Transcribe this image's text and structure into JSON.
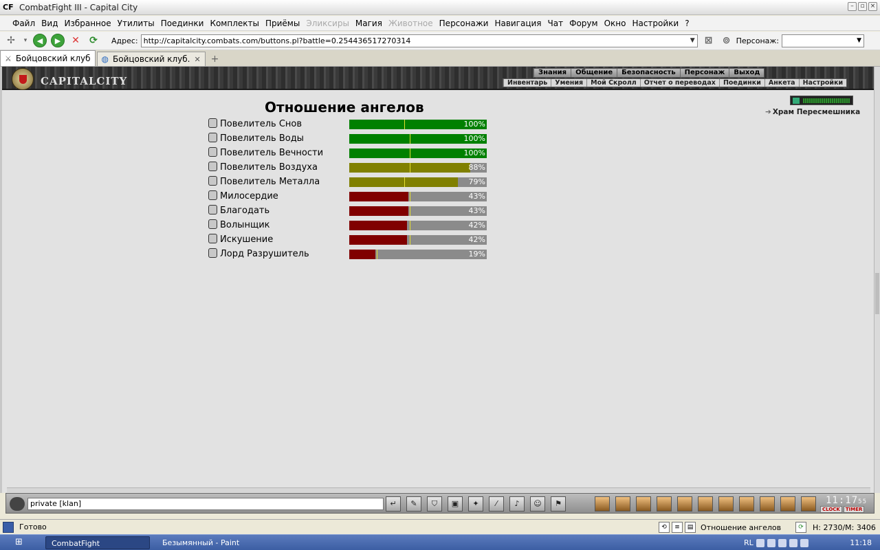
{
  "window": {
    "app_icon": "CF",
    "title": "CombatFight III - Capital City",
    "buttons": [
      "–",
      "▫",
      "×"
    ]
  },
  "menu": [
    {
      "label": "Файл",
      "disabled": false
    },
    {
      "label": "Вид",
      "disabled": false
    },
    {
      "label": "Избранное",
      "disabled": false
    },
    {
      "label": "Утилиты",
      "disabled": false
    },
    {
      "label": "Поединки",
      "disabled": false
    },
    {
      "label": "Комплекты",
      "disabled": false
    },
    {
      "label": "Приёмы",
      "disabled": false
    },
    {
      "label": "Эликсиры",
      "disabled": true
    },
    {
      "label": "Магия",
      "disabled": false
    },
    {
      "label": "Животное",
      "disabled": true
    },
    {
      "label": "Персонажи",
      "disabled": false
    },
    {
      "label": "Навигация",
      "disabled": false
    },
    {
      "label": "Чат",
      "disabled": false
    },
    {
      "label": "Форум",
      "disabled": false
    },
    {
      "label": "Окно",
      "disabled": false
    },
    {
      "label": "Настройки",
      "disabled": false
    },
    {
      "label": "?",
      "disabled": false
    }
  ],
  "address": {
    "label": "Адрес:",
    "url": "http://capitalcity.combats.com/buttons.pl?battle=0.254436517270314",
    "character_label": "Персонаж:",
    "character_value": ""
  },
  "tabs": [
    {
      "label": "Бойцовский клуб",
      "active": true
    },
    {
      "label": "Бойцовский клуб.",
      "active": false
    }
  ],
  "game": {
    "logo_text": "CAPITALCITY",
    "nav_top": [
      "Знания",
      "Общение",
      "Безопасность",
      "Персонаж",
      "Выход"
    ],
    "nav_sub": [
      "Инвентарь",
      "Умения",
      "Мой Скролл",
      "Отчет о переводах",
      "Поединки",
      "Анкета",
      "Настройки"
    ],
    "temple_link": "Храм Пересмешника",
    "page_title": "Отношение ангелов",
    "angels": [
      {
        "name": "Повелитель Снов",
        "percent": 100,
        "label": "100%",
        "color": "#008000",
        "mark": 40
      },
      {
        "name": "Повелитель Воды",
        "percent": 100,
        "label": "100%",
        "color": "#008000",
        "mark": 44
      },
      {
        "name": "Повелитель Вечности",
        "percent": 100,
        "label": "100%",
        "color": "#008000",
        "mark": 44
      },
      {
        "name": "Повелитель Воздуха",
        "percent": 88,
        "label": "88%",
        "color": "#808000",
        "mark": 44
      },
      {
        "name": "Повелитель Металла",
        "percent": 79,
        "label": "79%",
        "color": "#808000",
        "mark": 40
      },
      {
        "name": "Милосердие",
        "percent": 43,
        "label": "43%",
        "color": "#800000",
        "mark": 44
      },
      {
        "name": "Благодать",
        "percent": 43,
        "label": "43%",
        "color": "#800000",
        "mark": 44
      },
      {
        "name": "Волынщик",
        "percent": 42,
        "label": "42%",
        "color": "#800000",
        "mark": 44
      },
      {
        "name": "Искушение",
        "percent": 42,
        "label": "42%",
        "color": "#800000",
        "mark": 44
      },
      {
        "name": "Лорд Разрушитель",
        "percent": 19,
        "label": "19%",
        "color": "#800000",
        "mark": 20
      }
    ],
    "chat_input": "private [klan]",
    "clock_digits": "11:17",
    "clock_seconds": "55",
    "clock_labels": [
      "CLOCK",
      "TIMER"
    ]
  },
  "status": {
    "text": "Готово",
    "page": "Отношение ангелов",
    "hm": "H: 2730/M: 3406"
  },
  "taskbar": {
    "tasks": [
      {
        "label": "CombatFight",
        "active": true
      },
      {
        "label": "Безымянный - Paint",
        "active": false
      }
    ],
    "lang": "RL",
    "time": "11:18"
  }
}
